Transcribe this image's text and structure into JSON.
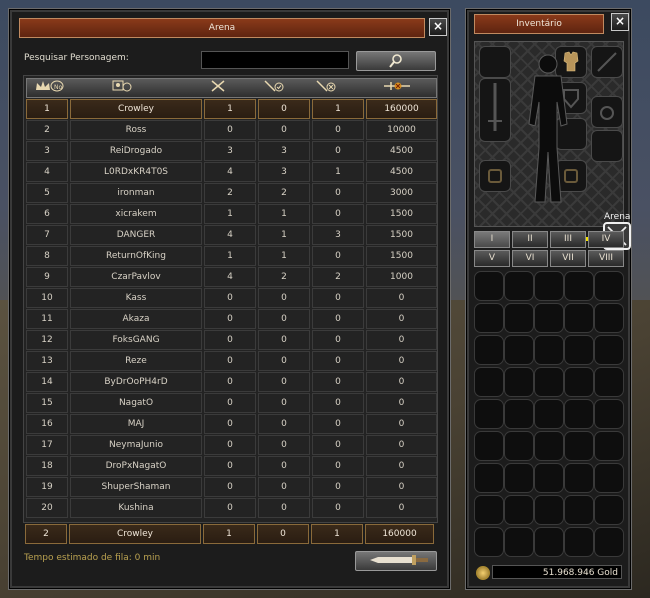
{
  "arena": {
    "title": "Arena",
    "search_label": "Pesquisar Personagem:",
    "search_value": "",
    "columns": [
      "No",
      "player",
      "total",
      "wins",
      "losses",
      "points"
    ],
    "rows": [
      [
        "1",
        "Crowley",
        "1",
        "0",
        "1",
        "160000"
      ],
      [
        "2",
        "Ross",
        "0",
        "0",
        "0",
        "10000"
      ],
      [
        "3",
        "ReiDrogado",
        "3",
        "3",
        "0",
        "4500"
      ],
      [
        "4",
        "L0RDxKR4T0S",
        "4",
        "3",
        "1",
        "4500"
      ],
      [
        "5",
        "ironman",
        "2",
        "2",
        "0",
        "3000"
      ],
      [
        "6",
        "xicrakem",
        "1",
        "1",
        "0",
        "1500"
      ],
      [
        "7",
        "DANGER",
        "4",
        "1",
        "3",
        "1500"
      ],
      [
        "8",
        "ReturnOfKing",
        "1",
        "1",
        "0",
        "1500"
      ],
      [
        "9",
        "CzarPavlov",
        "4",
        "2",
        "2",
        "1000"
      ],
      [
        "10",
        "Kass",
        "0",
        "0",
        "0",
        "0"
      ],
      [
        "11",
        "Akaza",
        "0",
        "0",
        "0",
        "0"
      ],
      [
        "12",
        "FoksGANG",
        "0",
        "0",
        "0",
        "0"
      ],
      [
        "13",
        "Reze",
        "0",
        "0",
        "0",
        "0"
      ],
      [
        "14",
        "ByDrOoPH4rD",
        "0",
        "0",
        "0",
        "0"
      ],
      [
        "15",
        "NagatO",
        "0",
        "0",
        "0",
        "0"
      ],
      [
        "16",
        "MAJ",
        "0",
        "0",
        "0",
        "0"
      ],
      [
        "17",
        "NeymaJunio",
        "0",
        "0",
        "0",
        "0"
      ],
      [
        "18",
        "DroPxNagatO",
        "0",
        "0",
        "0",
        "0"
      ],
      [
        "19",
        "ShuperShaman",
        "0",
        "0",
        "0",
        "0"
      ],
      [
        "20",
        "Kushina",
        "0",
        "0",
        "0",
        "0"
      ]
    ],
    "my_row": [
      "2",
      "Crowley",
      "1",
      "0",
      "1",
      "160000"
    ],
    "queue_text": "Tempo estimado de fila: 0 min"
  },
  "inventory": {
    "title": "Inventário",
    "arena_label": "Arena",
    "tabs": [
      "I",
      "II",
      "III",
      "IV",
      "V",
      "VI",
      "VII",
      "VIII"
    ],
    "active_tab": 0,
    "gold": "51.968.946 Gold"
  },
  "colors": {
    "title_bar": "#7a3018",
    "highlight_row": "#2e2014",
    "queue_text": "#b8a050",
    "arrow": "#f2e000"
  }
}
